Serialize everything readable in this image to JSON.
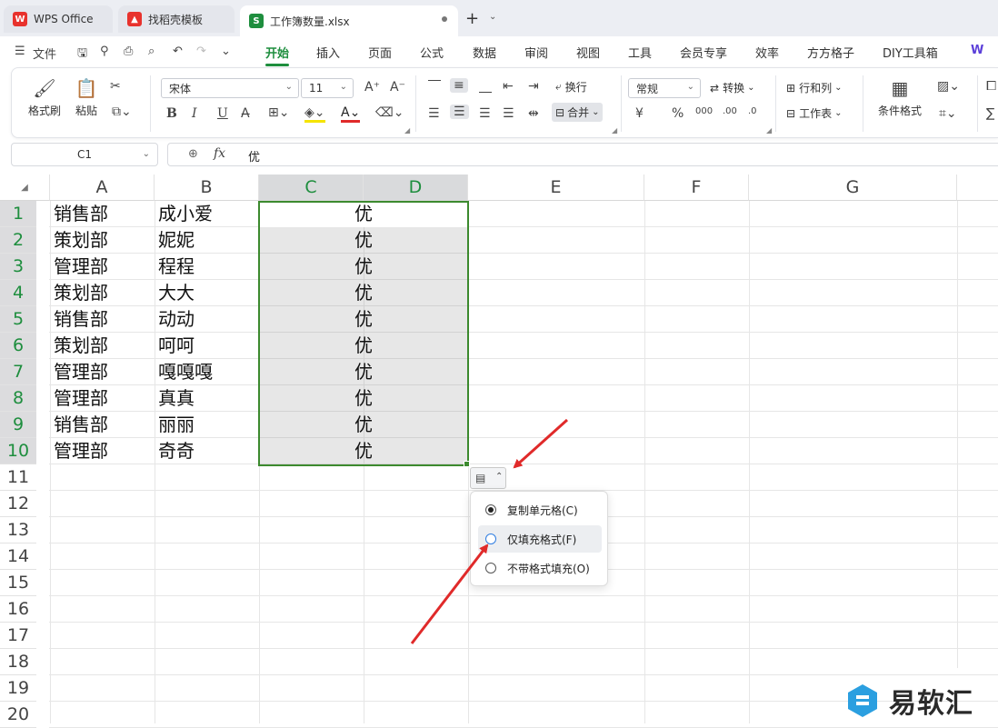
{
  "tabs": [
    {
      "label": "WPS Office",
      "icon": "wps-logo-icon",
      "color": "#e8322d"
    },
    {
      "label": "找稻壳模板",
      "icon": "docer-logo-icon",
      "color": "#e8322d"
    },
    {
      "label": "工作簿数量.xlsx",
      "icon": "spreadsheet-s-icon",
      "color": "#1e8e3e"
    }
  ],
  "menu": {
    "file": "文件",
    "items": [
      "开始",
      "插入",
      "页面",
      "公式",
      "数据",
      "审阅",
      "视图",
      "工具",
      "会员专享",
      "效率",
      "方方格子",
      "DIY工具箱"
    ],
    "active": "开始",
    "right_partial": "W"
  },
  "ribbon": {
    "format_painter": "格式刷",
    "paste": "粘贴",
    "font_name": "宋体",
    "font_size": "11",
    "bold": "B",
    "italic": "I",
    "underline": "U",
    "wrap": "换行",
    "merge": "合并",
    "number_format": "常规",
    "convert": "转换",
    "row_col": "行和列",
    "worksheet": "工作表",
    "cond_format": "条件格式",
    "currency": "¥",
    "percent": "%",
    "thousands": "000",
    "dec_more": ".00",
    "dec_less": ".0"
  },
  "formula_bar": {
    "name_box": "C1",
    "fx": "fx",
    "value": "优"
  },
  "sheet": {
    "columns": [
      "A",
      "B",
      "C",
      "D",
      "E",
      "F",
      "G"
    ],
    "rows": [
      "1",
      "2",
      "3",
      "4",
      "5",
      "6",
      "7",
      "8",
      "9",
      "10",
      "11",
      "12",
      "13",
      "14",
      "15",
      "16",
      "17",
      "18",
      "19",
      "20"
    ],
    "data": [
      {
        "a": "销售部",
        "b": "成小爱",
        "cd": "优"
      },
      {
        "a": "策划部",
        "b": "妮妮",
        "cd": "优"
      },
      {
        "a": "管理部",
        "b": "程程",
        "cd": "优"
      },
      {
        "a": "策划部",
        "b": "大大",
        "cd": "优"
      },
      {
        "a": "销售部",
        "b": "动动",
        "cd": "优"
      },
      {
        "a": "策划部",
        "b": "呵呵",
        "cd": "优"
      },
      {
        "a": "管理部",
        "b": "嘎嘎嘎",
        "cd": "优"
      },
      {
        "a": "管理部",
        "b": "真真",
        "cd": "优"
      },
      {
        "a": "销售部",
        "b": "丽丽",
        "cd": "优"
      },
      {
        "a": "管理部",
        "b": "奇奇",
        "cd": "优"
      }
    ],
    "selected_columns": [
      "C",
      "D"
    ],
    "selected_rows": 10
  },
  "autofill_menu": {
    "options": [
      {
        "label": "复制单元格(C)",
        "checked": true
      },
      {
        "label": "仅填充格式(F)",
        "checked": false
      },
      {
        "label": "不带格式填充(O)",
        "checked": false
      }
    ],
    "hovered_index": 1
  },
  "watermark": {
    "text": "易软汇"
  },
  "colors": {
    "accent": "#1e8e3e",
    "selection_border": "#3c8a2e",
    "arrow": "#e02a2a"
  }
}
